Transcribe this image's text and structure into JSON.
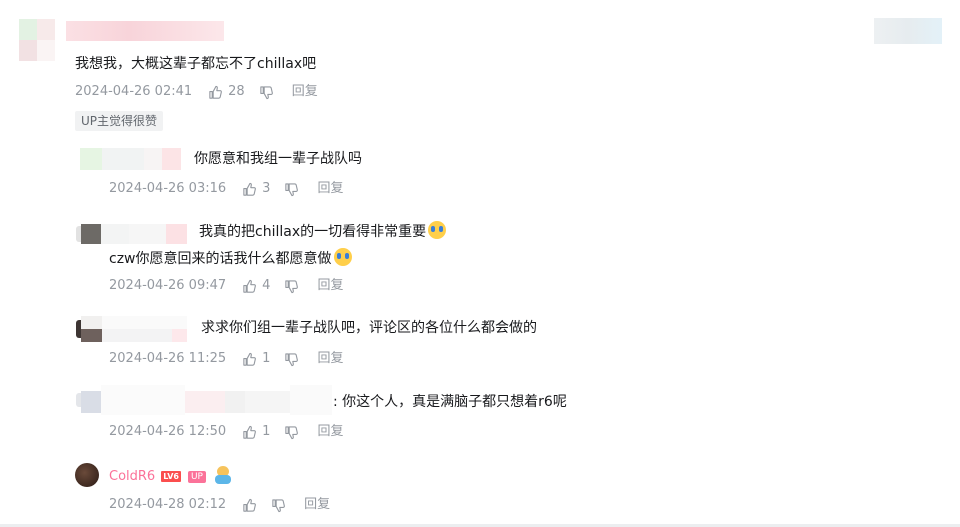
{
  "main_comment": {
    "text": "我想我，大概这辈子都忘不了chillax吧",
    "time": "2024-04-26 02:41",
    "likes": "28",
    "reply_label": "回复",
    "badge": "UP主觉得很赞"
  },
  "replies": [
    {
      "text": "你愿意和我组一辈子战队吗",
      "time": "2024-04-26 03:16",
      "likes": "3",
      "reply_label": "回复"
    },
    {
      "text": "我真的把chillax的一切看得非常重要",
      "text2": "czw你愿意回来的话我什么都愿意做",
      "time": "2024-04-26 09:47",
      "likes": "4",
      "reply_label": "回复"
    },
    {
      "text": "求求你们组一辈子战队吧，评论区的各位什么都会做的",
      "time": "2024-04-26 11:25",
      "likes": "1",
      "reply_label": "回复"
    },
    {
      "text": ": 你这个人，真是满脑子都只想着r6呢",
      "time": "2024-04-26 12:50",
      "likes": "1",
      "reply_label": "回复"
    }
  ],
  "up_reply": {
    "username": "ColdR6",
    "level": "LV6",
    "up_tag": "UP",
    "time": "2024-04-28 02:12",
    "reply_label": "回复"
  },
  "colors": {
    "accent_pink": "#fb7299",
    "meta_gray": "#9499a0"
  },
  "icons": [
    "thumb-up-icon",
    "thumb-down-icon",
    "crying-emoji-icon",
    "sticker-icon"
  ]
}
